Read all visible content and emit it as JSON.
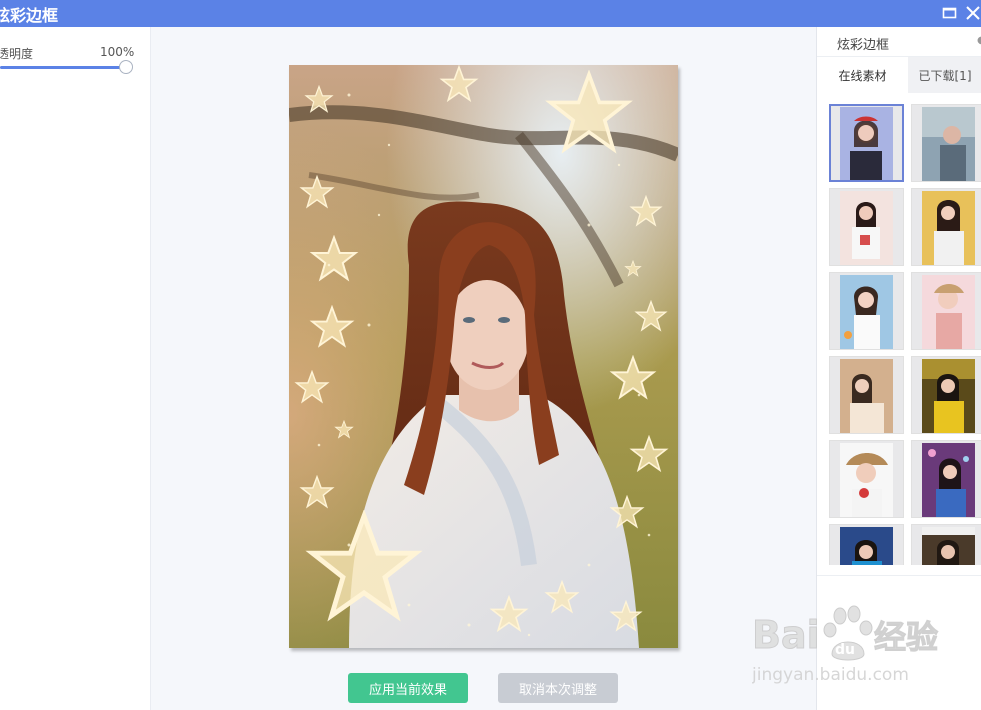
{
  "window": {
    "title": "炫彩边框",
    "maximize_icon": "maximize-icon",
    "close_icon": "close-icon"
  },
  "left_panel": {
    "opacity_label": "透明度",
    "opacity_value": "100%",
    "opacity_level": 1.0
  },
  "center": {
    "apply_button": "应用当前效果",
    "cancel_button": "取消本次调整"
  },
  "right_panel": {
    "header": "炫彩边框",
    "tabs": [
      {
        "label": "在线素材",
        "active": true
      },
      {
        "label": "已下载[1]",
        "active": false
      }
    ],
    "selected_index": 0
  },
  "watermark": {
    "brand": "Bai du 经验",
    "url": "jingyan.baidu.com"
  },
  "colors": {
    "titlebar": "#5b82e6",
    "apply": "#42c690",
    "cancel": "#c8ccd3",
    "selected_border": "#6b82d6"
  }
}
